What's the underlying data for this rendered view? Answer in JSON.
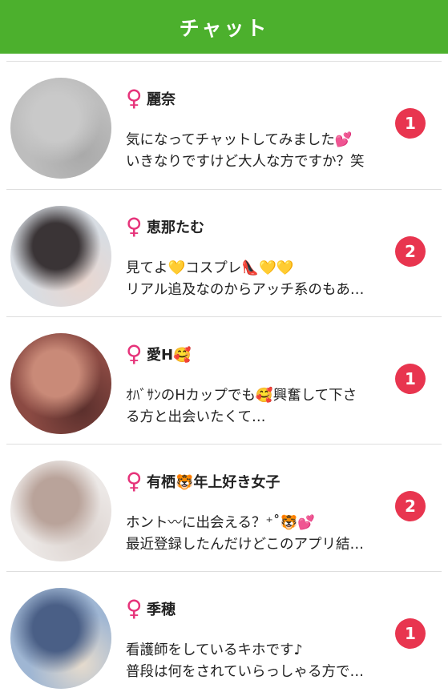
{
  "header": {
    "title": "チャット"
  },
  "chats": [
    {
      "name": "麗奈",
      "message_line1": "気になってチャットしてみました💕",
      "message_line2": "いきなりですけど大人な方ですか？笑",
      "unread": "1",
      "avatar_colors": [
        "#bdbdbd",
        "#c9c9c9",
        "#a9a9a9"
      ]
    },
    {
      "name": "恵那たむ",
      "message_line1": "見てよ💛コスプレ👠💛💛",
      "message_line2": "リアル追及なのからアッチ系のもあ…",
      "unread": "2",
      "avatar_colors": [
        "#d8dde3",
        "#3a3436",
        "#e9d6cf"
      ]
    },
    {
      "name": "愛H🥰",
      "message_line1": "ｵﾊﾞｻﾝのHカップでも🥰興奮して下さ",
      "message_line2": "る方と出会いたくて…",
      "unread": "1",
      "avatar_colors": [
        "#8b4a43",
        "#c98a78",
        "#5a2f2c"
      ]
    },
    {
      "name": "有栖🐯年上好き女子",
      "message_line1": "ホント〰に出会える？⁺˚🐯💕",
      "message_line2": "最近登録したんだけどこのアプリ結…",
      "unread": "2",
      "avatar_colors": [
        "#ece8e6",
        "#b9a39a",
        "#dcd3cf"
      ]
    },
    {
      "name": "季穂",
      "message_line1": "看護師をしているキホです♪",
      "message_line2": "普段は何をされていらっしゃる方で…",
      "unread": "1",
      "avatar_colors": [
        "#9fb6d3",
        "#4a5f86",
        "#e7dccd"
      ]
    }
  ],
  "icons": {
    "gender": "female-icon"
  },
  "colors": {
    "header": "#4cb02d",
    "badge": "#e8354f",
    "gender": "#e6337a"
  }
}
